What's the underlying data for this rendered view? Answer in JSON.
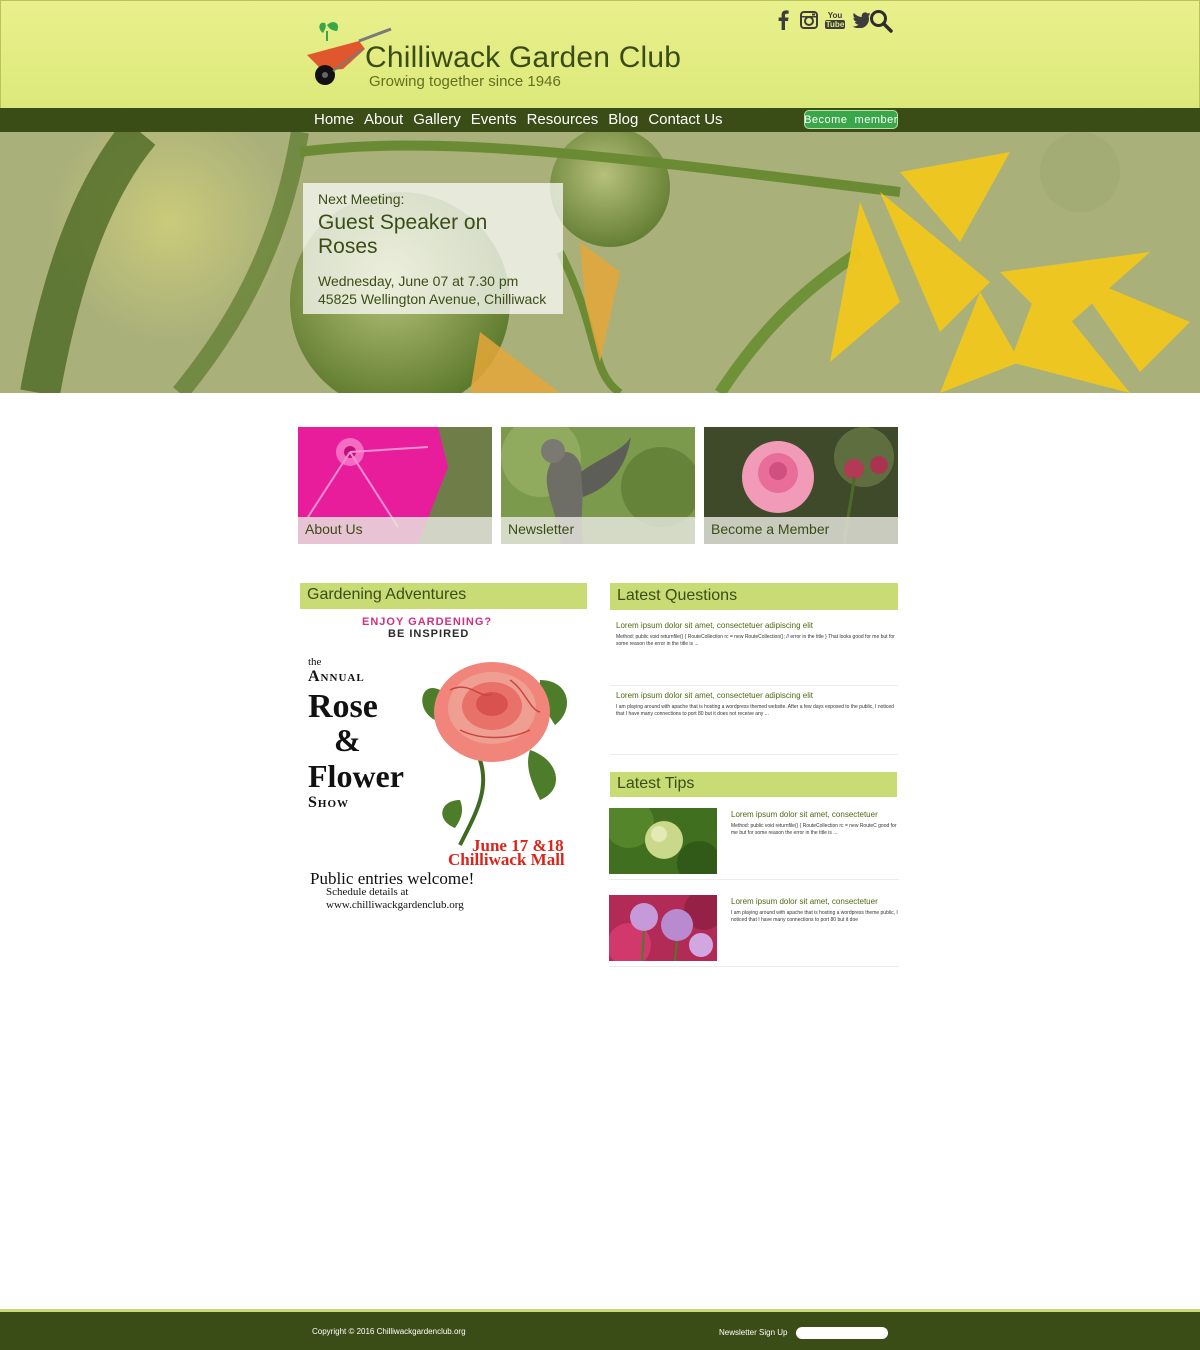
{
  "brand": {
    "title": "Chilliwack Garden Club",
    "tagline": "Growing together since 1946"
  },
  "social": {
    "icons": [
      "facebook-icon",
      "instagram-icon",
      "youtube-icon",
      "twitter-icon",
      "search-icon"
    ],
    "youtube_label_top": "You",
    "youtube_label_bottom": "Tube"
  },
  "nav": {
    "items": [
      "Home",
      "About",
      "Gallery",
      "Events",
      "Resources",
      "Blog",
      "Contact Us"
    ],
    "member_button": "Become  member"
  },
  "hero": {
    "label": "Next Meeting:",
    "title": "Guest Speaker on Roses",
    "date": "Wednesday, June 07 at 7.30 pm",
    "address": "45825 Wellington Avenue, Chilliwack"
  },
  "tiles": [
    "About Us",
    "Newsletter",
    "Become a Member"
  ],
  "adventures": {
    "heading": "Gardening Adventures",
    "poster": {
      "line1": "ENJOY GARDENING?",
      "line2": "BE INSPIRED",
      "the": "the",
      "annual": "Annual",
      "rose": "Rose",
      "amp": "&",
      "flower": "Flower",
      "show": "Show",
      "dates": "June 17 &18",
      "venue": "Chilliwack Mall",
      "entries": "Public entries welcome!",
      "schedule": "Schedule details at",
      "url": "www.chilliwackgardenclub.org"
    }
  },
  "questions": {
    "heading": "Latest Questions",
    "items": [
      {
        "title": "Lorem ipsum dolor sit amet, consectetuer adipiscing elit",
        "body": "Method: public void returnfile() { RouteCollection rc = new RouteCollection(); // error in the title } That looks good for me but for some reason the error in the title is ..."
      },
      {
        "title": "Lorem ipsum dolor sit amet, consectetuer adipiscing elit",
        "body": "I am playing around with apache that is hosting a wordpress themed website. After a few days exposed to the public, I noticed that I have many connections to port 80 but it does not receive any ..."
      }
    ]
  },
  "tips": {
    "heading": "Latest Tips",
    "items": [
      {
        "title": "Lorem ipsum dolor sit amet, consectetuer",
        "body": "Method: public void returnfile() { RouteCollection rc = new RouteC good for me but for some reason the error in the title is ..."
      },
      {
        "title": "Lorem ipsum dolor sit amet, consectetuer",
        "body": "I am playing around with apache that is hosting a wordpress theme public, I noticed that I have many connections to port 80 but it doe"
      }
    ]
  },
  "footer": {
    "copyright": "Copyright © 2016 Chilliwackgardenclub.org",
    "newsletter_label": "Newsletter Sign Up",
    "newsletter_placeholder": ""
  },
  "colors": {
    "header_bg": "#e4ee86",
    "dark_green": "#3b4d16",
    "section_bar": "#c8db75",
    "member_button": "#3aa64a"
  }
}
